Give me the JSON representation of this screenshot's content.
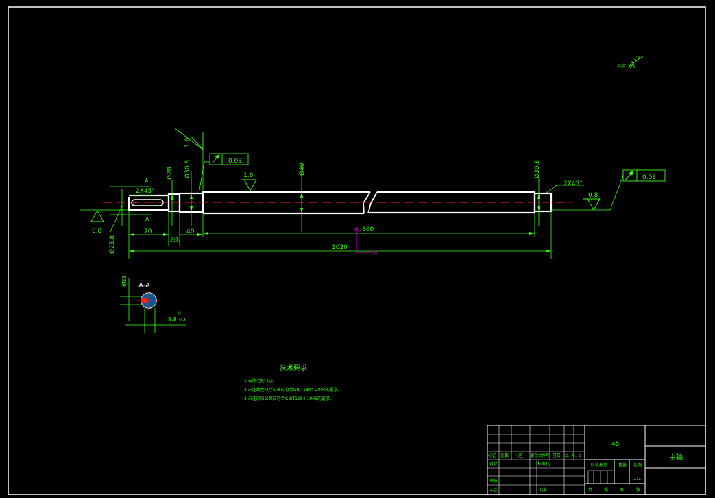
{
  "drawing": {
    "surface_roughness": {
      "general": "1.6",
      "left_symbol": "0.8",
      "shaft_body": "1.6",
      "right_end": "0.8",
      "top_right_label": "其余",
      "top_right_value": "1.1"
    },
    "runout": {
      "left_value": "0.03",
      "right_value": "0.03"
    },
    "dimensions": {
      "chamfer_left": "2X45°",
      "chamfer_right": "2X45°",
      "dia_28": "Ø28",
      "dia_30_left": "Ø30.8",
      "dia_40": "Ø40",
      "dia_30_right": "Ø30.8",
      "dia_25": "Ø25.8",
      "len_70": "70",
      "len_20": "20",
      "len_40": "40",
      "len_860": "860",
      "len_1020": "1020"
    },
    "section": {
      "cut_label_top": "A",
      "cut_label_bottom": "A",
      "title": "A-A",
      "keyway_width": "6N9",
      "depth_main": "9.8",
      "depth_upper": "0",
      "depth_lower": "-0.2"
    },
    "colors": {
      "line": "#39ff14",
      "outline": "#ffffff",
      "centerline": "#ff2020",
      "frame": "#ffffff",
      "ucs": "#c000c0"
    }
  },
  "tech_requirements": {
    "title": "技术要求",
    "items": [
      "1.去除毛刺飞边。",
      "2.未注线性尺寸公差应符合GB/T1804-2000的要求。",
      "3.未注形位公差应符合GB/T1184-1996的要求。"
    ]
  },
  "title_block": {
    "material": "45",
    "part_name": "主轴",
    "scale": "1:1",
    "row_labels": [
      "标记",
      "处数",
      "分区",
      "更改文件号",
      "签名",
      "年、月、日"
    ],
    "design_label": "设计",
    "standardize_label": "标准化",
    "check_label": "审核",
    "process_label": "工艺",
    "approve_label": "批准",
    "stage_label": "阶段标记",
    "weight_label": "重量",
    "scale_label": "比例",
    "sheet_labels": [
      "共",
      "张",
      "第",
      "张"
    ]
  }
}
